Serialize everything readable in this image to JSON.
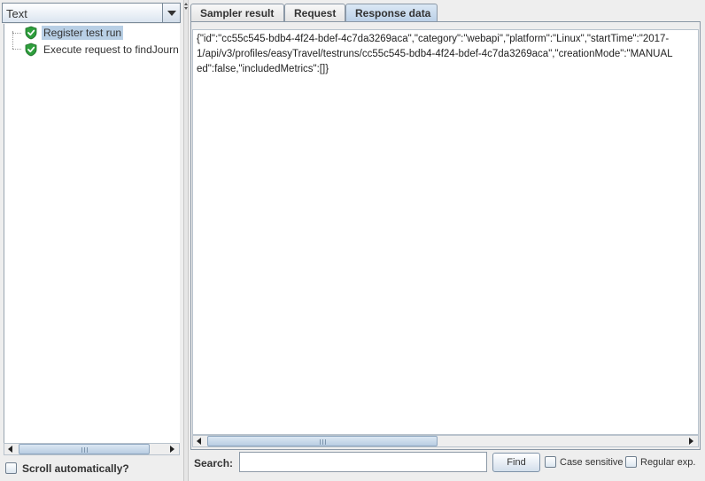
{
  "left": {
    "renderer_combo": {
      "selected": "Text"
    },
    "tree": {
      "items": [
        {
          "label": "Register test run",
          "status": "success",
          "selected": true
        },
        {
          "label": "Execute request to findJourn",
          "status": "success",
          "selected": false
        }
      ]
    },
    "scroll_auto_label": "Scroll automatically?"
  },
  "right": {
    "tabs": [
      {
        "label": "Sampler result",
        "active": false
      },
      {
        "label": "Request",
        "active": false
      },
      {
        "label": "Response data",
        "active": true
      }
    ],
    "response_lines": [
      "{\"id\":\"cc55c545-bdb4-4f24-bdef-4c7da3269aca\",\"category\":\"webapi\",\"platform\":\"Linux\",\"startTime\":\"2017-",
      "1/api/v3/profiles/easyTravel/testruns/cc55c545-bdb4-4f24-bdef-4c7da3269aca\",\"creationMode\":\"MANUAL",
      "ed\":false,\"includedMetrics\":[]}"
    ],
    "search": {
      "label": "Search:",
      "value": "",
      "find_label": "Find",
      "case_sensitive_label": "Case sensitive",
      "regular_exp_label": "Regular exp."
    }
  },
  "colors": {
    "selection": "#b8cfe5",
    "active_tab": "#c9dbee",
    "success_icon": "#2e9e3c"
  },
  "icons": [
    "chevron-down-icon",
    "success-shield-icon",
    "scroll-left-icon",
    "scroll-right-icon"
  ]
}
